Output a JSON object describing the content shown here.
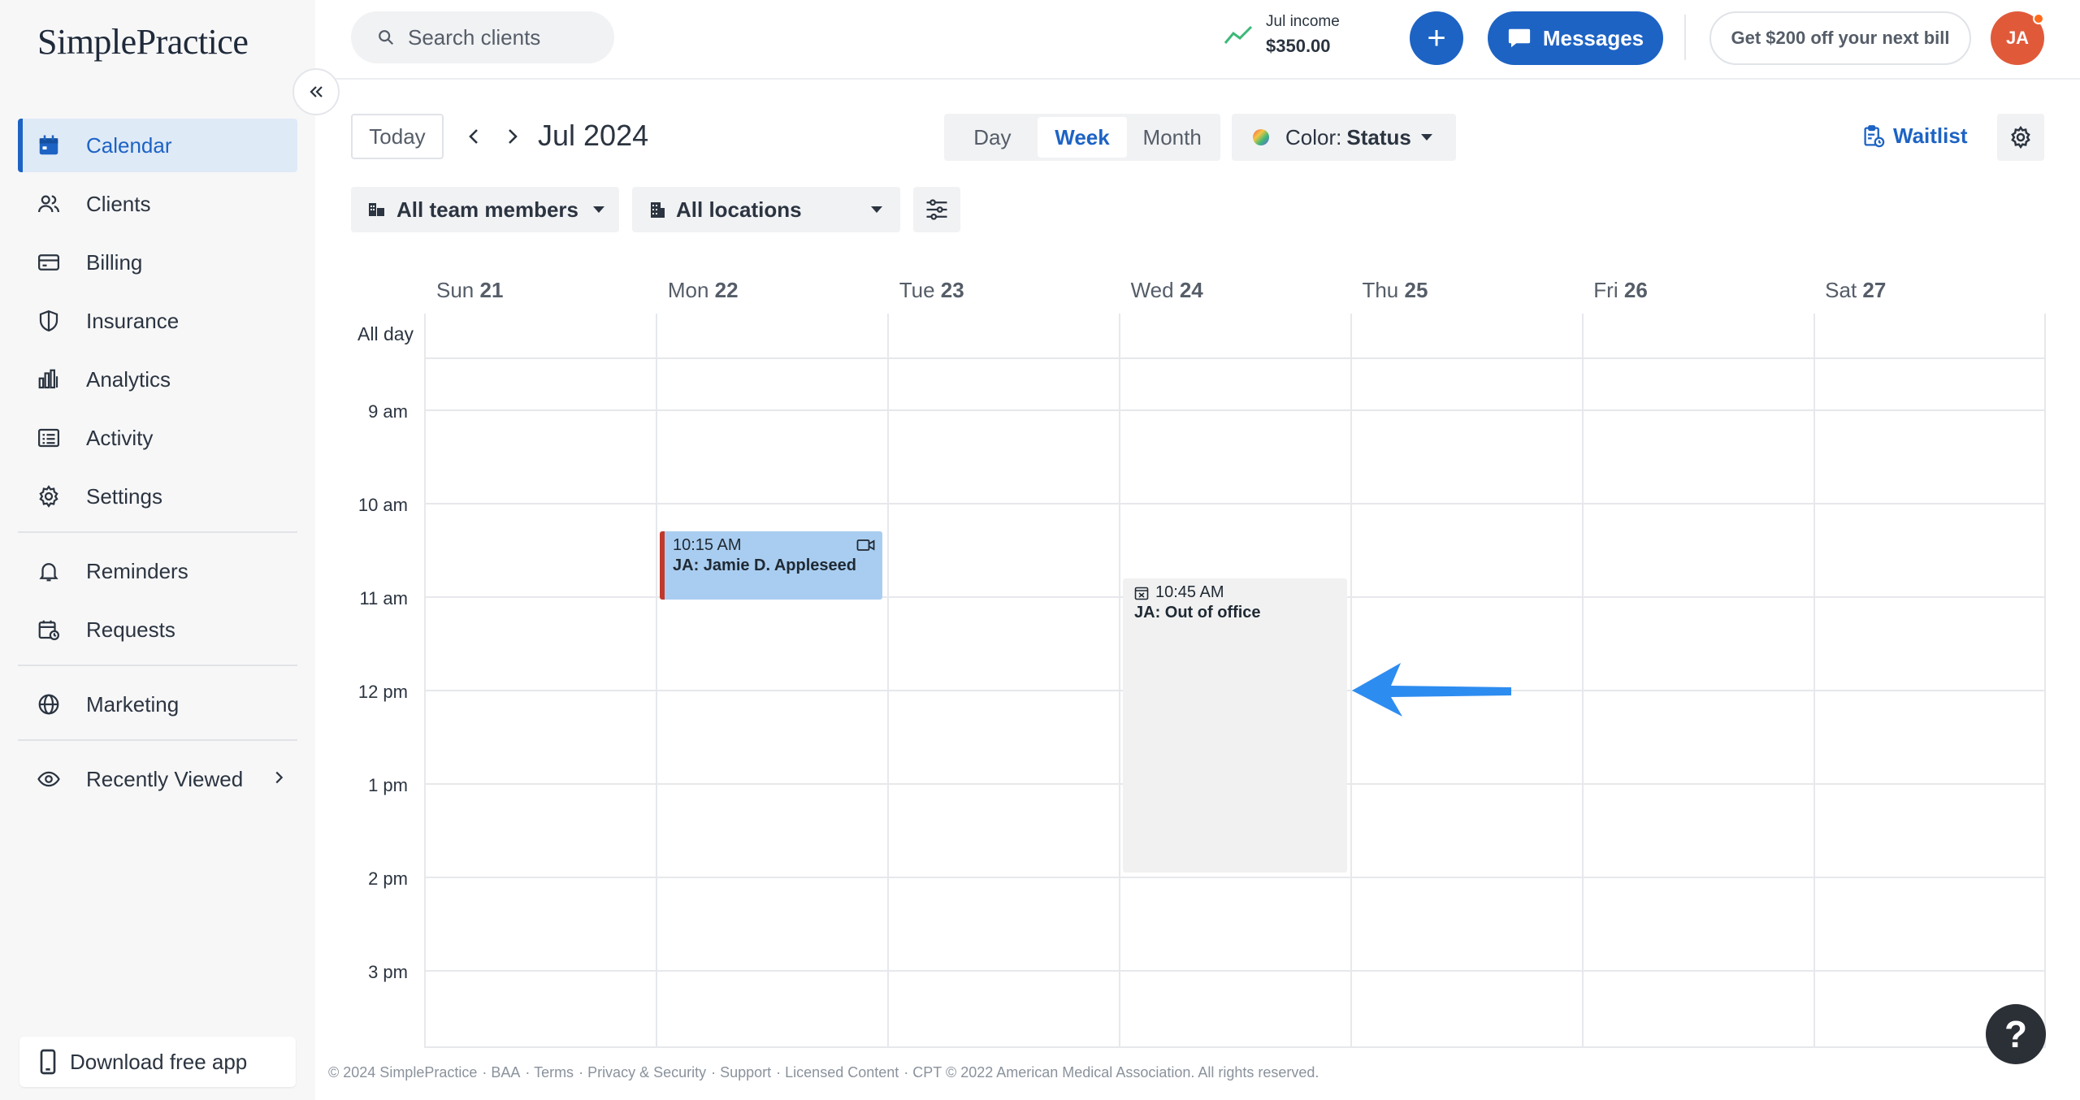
{
  "brand": {
    "logo_text": "SimplePractice"
  },
  "sidebar": {
    "items": [
      {
        "label": "Calendar",
        "icon": "calendar-icon",
        "active": true
      },
      {
        "label": "Clients",
        "icon": "users-icon"
      },
      {
        "label": "Billing",
        "icon": "credit-card-icon"
      },
      {
        "label": "Insurance",
        "icon": "shield-icon"
      },
      {
        "label": "Analytics",
        "icon": "bar-chart-icon"
      },
      {
        "label": "Activity",
        "icon": "list-icon"
      },
      {
        "label": "Settings",
        "icon": "gear-icon"
      },
      {
        "label": "Reminders",
        "icon": "bell-icon"
      },
      {
        "label": "Requests",
        "icon": "calendar-clock-icon"
      },
      {
        "label": "Marketing",
        "icon": "globe-icon"
      },
      {
        "label": "Recently Viewed",
        "icon": "eye-icon"
      }
    ],
    "download_app": "Download free app"
  },
  "topbar": {
    "search_placeholder": "Search clients",
    "income_label": "Jul income",
    "income_value": "$350.00",
    "plus_label": "+",
    "messages_label": "Messages",
    "promo_label": "Get $200 off your next bill",
    "avatar_initials": "JA"
  },
  "toolbar": {
    "today": "Today",
    "month_title": "Jul 2024",
    "views": [
      "Day",
      "Week",
      "Month"
    ],
    "active_view": "Week",
    "color_label": "Color:",
    "color_value": "Status",
    "waitlist": "Waitlist",
    "team_filter": "All team members",
    "location_filter": "All locations"
  },
  "calendar": {
    "days": [
      {
        "name": "Sun",
        "num": "21"
      },
      {
        "name": "Mon",
        "num": "22"
      },
      {
        "name": "Tue",
        "num": "23"
      },
      {
        "name": "Wed",
        "num": "24"
      },
      {
        "name": "Thu",
        "num": "25"
      },
      {
        "name": "Fri",
        "num": "26"
      },
      {
        "name": "Sat",
        "num": "27"
      }
    ],
    "all_day_label": "All day",
    "time_labels": [
      "9 am",
      "10 am",
      "11 am",
      "12 pm",
      "1 pm",
      "2 pm",
      "3 pm"
    ],
    "events": [
      {
        "time": "10:15 AM",
        "title": "JA: Jamie D. Appleseed",
        "type": "appointment",
        "icon": "video-camera-icon"
      },
      {
        "time": "10:45 AM",
        "title": "JA: Out of office",
        "type": "out-of-office",
        "icon": "calendar-x-icon"
      }
    ]
  },
  "colors": {
    "primary": "#1d63c4",
    "appointment_bg": "#a9cdf0",
    "appointment_border": "#c0392b",
    "ooo_bg": "#f1f1f1",
    "arrow": "#2d8cf0",
    "avatar": "#e05a3a"
  },
  "footer": {
    "copyright": "© 2024 SimplePractice",
    "links": [
      "BAA",
      "Terms",
      "Privacy & Security",
      "Support",
      "Licensed Content"
    ],
    "cpt": "CPT © 2022 American Medical Association. All rights reserved."
  },
  "help_label": "?"
}
